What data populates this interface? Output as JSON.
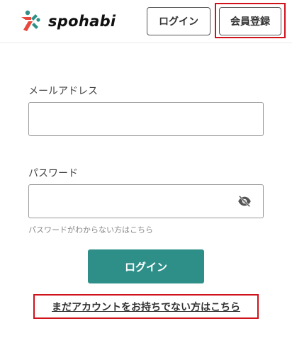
{
  "header": {
    "logo_text": "spohabi",
    "login_label": "ログイン",
    "register_label": "会員登録"
  },
  "form": {
    "email_label": "メールアドレス",
    "email_value": "",
    "password_label": "パスワード",
    "password_value": "",
    "forgot_link": "パスワードがわからない方はこちら",
    "submit_label": "ログイン",
    "signup_link": "まだアカウントをお持ちでない方はこちら"
  },
  "icons": {
    "logo": "spohabi-logo-icon",
    "password_visibility": "eye-off-icon"
  },
  "colors": {
    "accent": "#2e8f89",
    "logo_red": "#e8473b",
    "logo_teal": "#2e8f89",
    "highlight": "#d0121b"
  }
}
